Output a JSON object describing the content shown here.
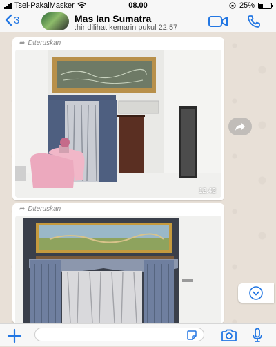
{
  "status_bar": {
    "carrier": "Tsel-PakaiMasker",
    "time": "08.00",
    "battery_percent": "25%",
    "battery_level": 0.25,
    "icons": [
      "signal-icon",
      "wifi-icon",
      "orientation-lock-icon",
      "battery-icon"
    ]
  },
  "header": {
    "back_count": "3",
    "contact_name": "Mas Ian Sumatra",
    "contact_status": ":hir dilihat kemarin pukul 22.57",
    "icons": [
      "back-chevron-icon",
      "video-call-icon",
      "phone-icon"
    ]
  },
  "messages": [
    {
      "forwarded_label": "Diteruskan",
      "time": "12.42",
      "content": "photo"
    },
    {
      "forwarded_label": "Diteruskan",
      "content": "photo"
    }
  ],
  "composer": {
    "placeholder": "",
    "icons": [
      "plus-icon",
      "sticker-icon",
      "camera-icon",
      "microphone-icon"
    ]
  },
  "colors": {
    "accent": "#2377e3",
    "header_bg": "#f7f7f7",
    "wallpaper": "#e8e0d7",
    "bubble": "#ffffff"
  }
}
